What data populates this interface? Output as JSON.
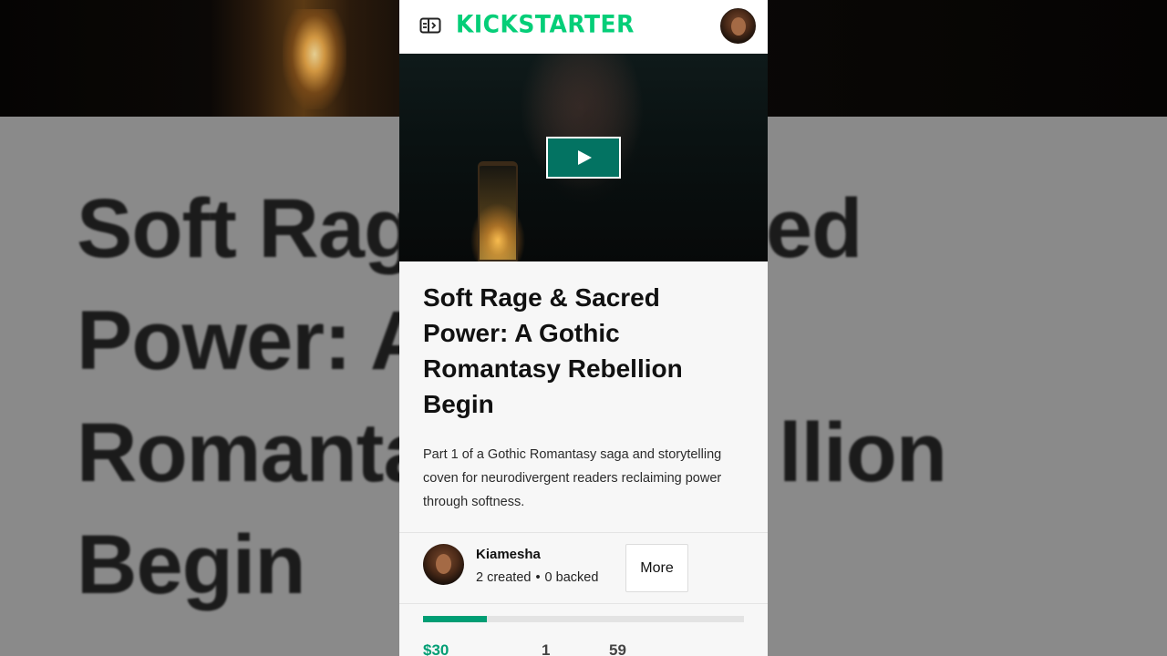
{
  "backdrop": {
    "title_lines": [
      "Soft Rag",
      "Power: A",
      "Romanta",
      "Begin"
    ],
    "title_right_lines": [
      "ed",
      "",
      "llion",
      ""
    ]
  },
  "header": {
    "logo_text": "KICKSTARTER",
    "menu_icon": "sidebar-toggle-icon",
    "avatar_icon": "user-avatar"
  },
  "video": {
    "play_icon": "play-icon"
  },
  "project": {
    "title": "Soft Rage & Sacred Power: A Gothic Romantasy Rebellion Begin",
    "blurb": "Part 1 of a Gothic Romantasy saga and storytelling coven for neurodivergent readers reclaiming power through softness."
  },
  "creator": {
    "name": "Kiamesha",
    "created": "2 created",
    "separator": "•",
    "backed": "0 backed",
    "more_label": "More"
  },
  "funding": {
    "progress_fraction": 0.2,
    "pledged": "$30",
    "backers": "1",
    "days": "59"
  },
  "colors": {
    "brand_green": "#05ce78",
    "accent_green": "#009e74",
    "play_button": "#037362"
  }
}
